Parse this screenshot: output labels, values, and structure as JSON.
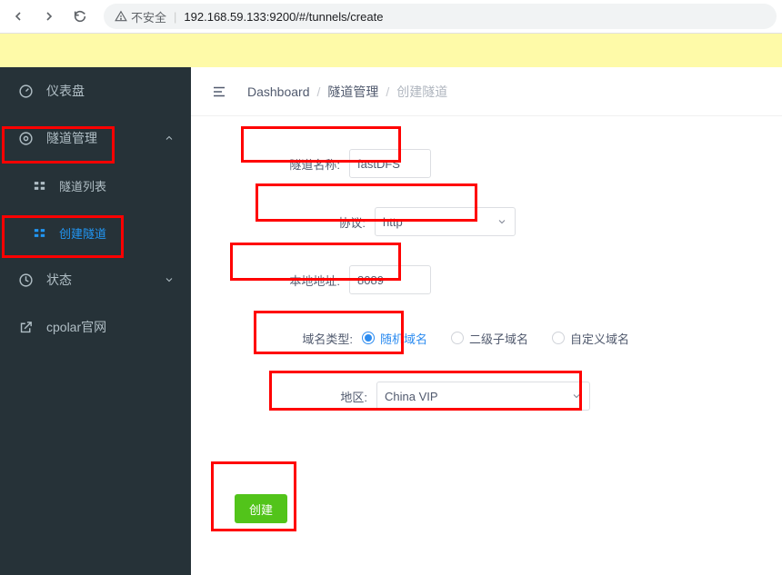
{
  "browser": {
    "insecure_label": "不安全",
    "url": "192.168.59.133:9200/#/tunnels/create"
  },
  "sidebar": {
    "dashboard": "仪表盘",
    "tunnel_manage": "隧道管理",
    "tunnel_list": "隧道列表",
    "tunnel_create": "创建隧道",
    "status": "状态",
    "cpolar_site": "cpolar官网"
  },
  "breadcrumb": {
    "a": "Dashboard",
    "b": "隧道管理",
    "c": "创建隧道"
  },
  "form": {
    "label_name": "隧道名称:",
    "value_name": "fastDFS",
    "label_proto": "协议:",
    "value_proto": "http",
    "label_addr": "本地地址:",
    "value_addr": "8089",
    "label_domain": "域名类型:",
    "radio_rand": "随机域名",
    "radio_sub": "二级子域名",
    "radio_cust": "自定义域名",
    "label_region": "地区:",
    "value_region": "China VIP",
    "create_btn": "创建"
  }
}
